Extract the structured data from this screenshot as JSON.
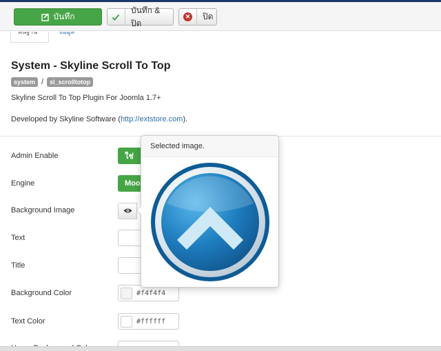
{
  "toolbar": {
    "save_label": "บันทึก",
    "save_close_label": "บันทึก & ปิด",
    "close_label": "ปิด"
  },
  "tabs": {
    "main": "พื้นฐาน",
    "details": "ข้อมูล"
  },
  "plugin": {
    "title": "System - Skyline Scroll To Top",
    "badge_group": "system",
    "badge_separator": "/",
    "badge_element": "sl_scrolltotop",
    "description": "Skyline Scroll To Top Plugin For Joomla 1.7+",
    "developed_prefix": "Developed by Skyline Software (",
    "developed_link": "http://extstore.com",
    "developed_suffix": ")."
  },
  "fields": {
    "admin_enable": {
      "label": "Admin Enable",
      "value": "ใช่"
    },
    "engine": {
      "label": "Engine",
      "value": "Mootools"
    },
    "background_image": {
      "label": "Background Image"
    },
    "text": {
      "label": "Text"
    },
    "title": {
      "label": "Title"
    },
    "background_color": {
      "label": "Background Color",
      "value": "#f4f4f4"
    },
    "text_color": {
      "label": "Text Color",
      "value": "#ffffff"
    },
    "hover_background_color": {
      "label": "Hover Background Color"
    }
  },
  "popover": {
    "header": "Selected image."
  },
  "colors": {
    "accent_green": "#46a546",
    "danger_red": "#bd362f",
    "link_blue": "#2f6ea8",
    "scroll_icon_blue": "#1f7fc0"
  }
}
